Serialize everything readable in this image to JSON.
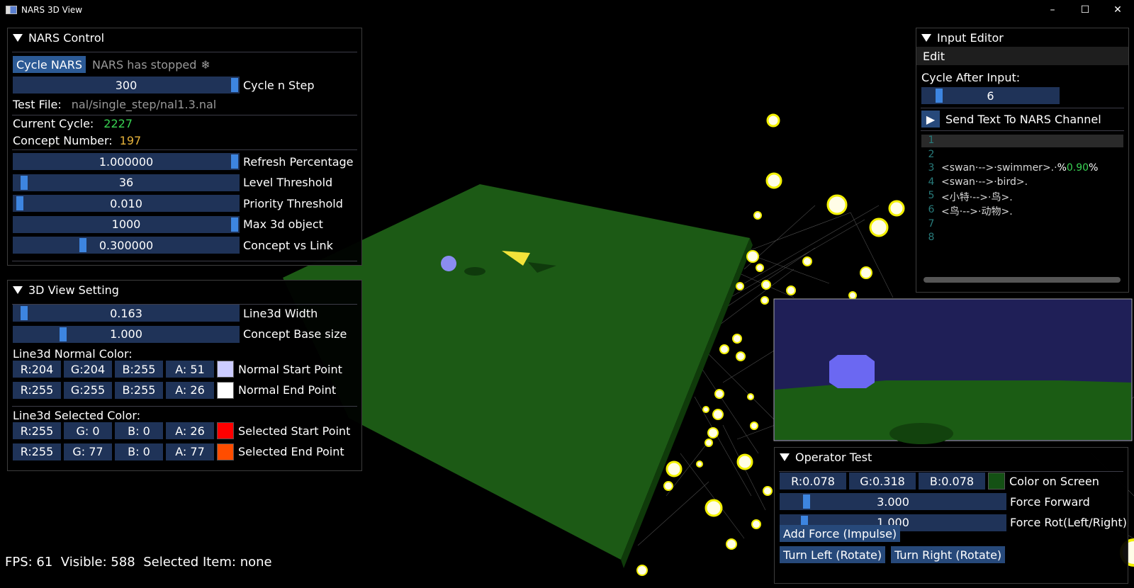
{
  "window": {
    "title": "NARS 3D View",
    "minimize": "–",
    "maximize": "☐",
    "close": "✕"
  },
  "nars_control": {
    "title": "NARS Control",
    "cycle_button": "Cycle NARS",
    "status": "NARS has stopped",
    "status_icon": "snowflake-icon",
    "cycle_n_step": {
      "value": "300",
      "label": "Cycle n Step",
      "level": 1.0
    },
    "test_file_label": "Test File:",
    "test_file_value": "nal/single_step/nal1.3.nal",
    "current_cycle_label": "Current Cycle:",
    "current_cycle_value": "2227",
    "concept_number_label": "Concept Number:",
    "concept_number_value": "197",
    "sliders": [
      {
        "value": "1.000000",
        "label": "Refresh Percentage",
        "level": 1.0
      },
      {
        "value": "36",
        "label": "Level Threshold",
        "level": 0.03
      },
      {
        "value": "0.010",
        "label": "Priority Threshold",
        "level": 0.01
      },
      {
        "value": "1000",
        "label": "Max 3d object",
        "level": 1.0
      },
      {
        "value": "0.300000",
        "label": "Concept vs Link",
        "level": 0.3
      }
    ]
  },
  "view_setting": {
    "title": "3D View Setting",
    "sliders": [
      {
        "value": "0.163",
        "label": "Line3d Width",
        "level": 0.03
      },
      {
        "value": "1.000",
        "label": "Concept Base size",
        "level": 0.21
      }
    ],
    "normal_color_label": "Line3d Normal Color:",
    "normal_rows": [
      {
        "r": "R:204",
        "g": "G:204",
        "b": "B:255",
        "a": "A: 51",
        "color": "#ccccff",
        "label": "Normal Start Point"
      },
      {
        "r": "R:255",
        "g": "G:255",
        "b": "B:255",
        "a": "A: 26",
        "color": "#ffffff",
        "label": "Normal End Point"
      }
    ],
    "selected_color_label": "Line3d Selected Color:",
    "selected_rows": [
      {
        "r": "R:255",
        "g": "G:  0",
        "b": "B:  0",
        "a": "A: 26",
        "color": "#ff0000",
        "label": "Selected Start Point"
      },
      {
        "r": "R:255",
        "g": "G: 77",
        "b": "B:  0",
        "a": "A: 77",
        "color": "#ff4d00",
        "label": "Selected End Point"
      }
    ]
  },
  "input_editor": {
    "title": "Input Editor",
    "menu_edit": "Edit",
    "cycle_after_label": "Cycle After Input:",
    "cycle_after_value": "6",
    "cycle_after_level": 0.1,
    "send_label": "Send Text To NARS Channel",
    "lines": [
      {
        "n": "1",
        "text": ""
      },
      {
        "n": "2",
        "text": ""
      },
      {
        "n": "3",
        "text": "<swan·-->·swimmer>.·",
        "pct_open": "%",
        "num": "0.90",
        "pct_close": "%"
      },
      {
        "n": "4",
        "text": "<swan·-->·bird>."
      },
      {
        "n": "5",
        "text": "<小特·-->·鸟>."
      },
      {
        "n": "6",
        "text": "<鸟·-->·动物>."
      },
      {
        "n": "7",
        "text": ""
      },
      {
        "n": "8",
        "text": ""
      }
    ]
  },
  "operator_test": {
    "title": "Operator Test",
    "r": "R:0.078",
    "g": "G:0.318",
    "b": "B:0.078",
    "color": "#145114",
    "color_label": "Color on Screen",
    "sliders": [
      {
        "value": "3.000",
        "label": "Force Forward",
        "level": 0.1
      },
      {
        "value": "1.000",
        "label": "Force Rot(Left/Right)",
        "level": 0.09
      }
    ],
    "add_force_button": "Add Force (Impulse)",
    "turn_left_button": "Turn Left (Rotate)",
    "turn_right_button": "Turn Right (Rotate)"
  },
  "status_bar": {
    "fps": "FPS: 61",
    "visible": "Visible: 588",
    "selected": "Selected Item: none"
  },
  "colors": {
    "slider_bg": "#1f3358",
    "slider_grab": "#3d85e0",
    "button": "#27497a",
    "ground": "#1b5c14"
  }
}
